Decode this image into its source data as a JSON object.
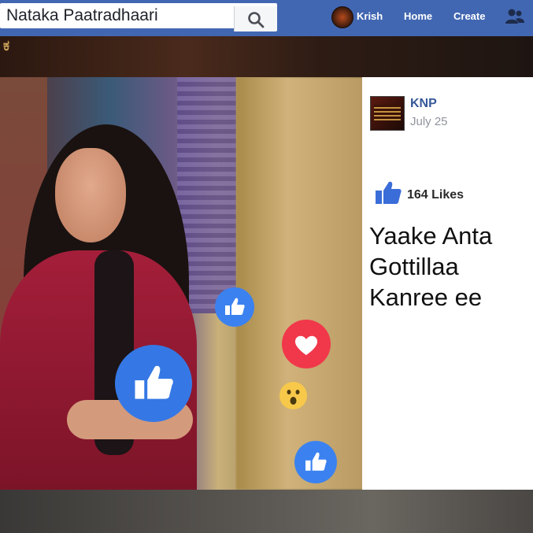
{
  "search": {
    "value": "Nataka Paatradhaari",
    "icon": "search-icon"
  },
  "nav": {
    "user_name": "Krish",
    "home_label": "Home",
    "create_label": "Create",
    "friends_icon": "friends-icon"
  },
  "background": {
    "strip_text": "ಕ",
    "bottom_text": ""
  },
  "reactions": [
    "like-icon",
    "like-icon",
    "love-icon",
    "wow-icon",
    "like-icon"
  ],
  "post": {
    "page_name": "KNP",
    "date": "July 25",
    "likes_text": "164 Likes",
    "text": "Yaake Anta\nGottillaa\nKanree ee"
  },
  "colors": {
    "facebook_blue": "#4267b2",
    "link_blue": "#365899",
    "like_blue": "#3b82f0",
    "love_red": "#f0384a",
    "wow_yellow": "#f7c84a"
  }
}
